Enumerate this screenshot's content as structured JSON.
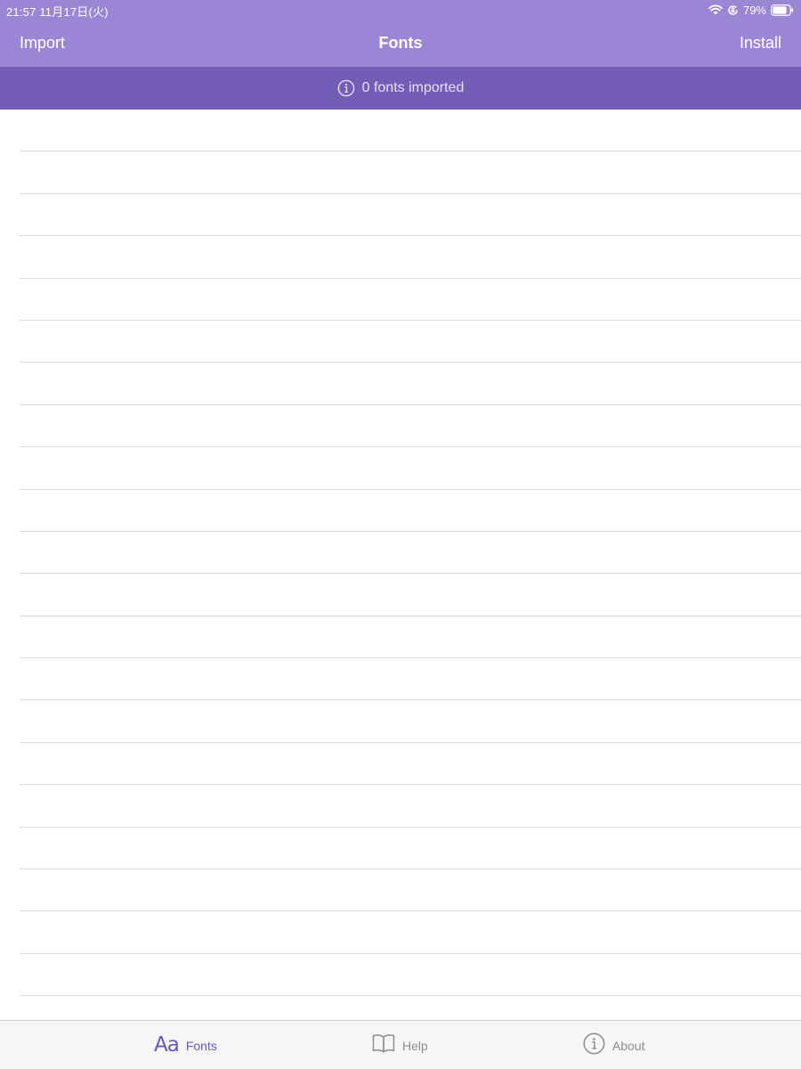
{
  "status_bar": {
    "time": "21:57  11月17日(火)",
    "battery": "79%",
    "icons": [
      "wifi-icon",
      "orientation-lock-icon",
      "battery-icon"
    ]
  },
  "nav": {
    "left_label": "Import",
    "title": "Fonts",
    "right_label": "Install"
  },
  "banner": {
    "icon": "info-icon",
    "text": "0 fonts imported"
  },
  "list": {
    "row_count": 21
  },
  "tabbar": {
    "tabs": [
      {
        "label": "Fonts",
        "icon": "aa-icon",
        "active": true
      },
      {
        "label": "Help",
        "icon": "book-icon",
        "active": false
      },
      {
        "label": "About",
        "icon": "info-icon",
        "active": false
      }
    ],
    "aa_glyph": "Aa"
  },
  "colors": {
    "header": "#9b86d6",
    "banner": "#735db6",
    "accent": "#6a55b5",
    "tab_inactive": "#8c8c91"
  }
}
